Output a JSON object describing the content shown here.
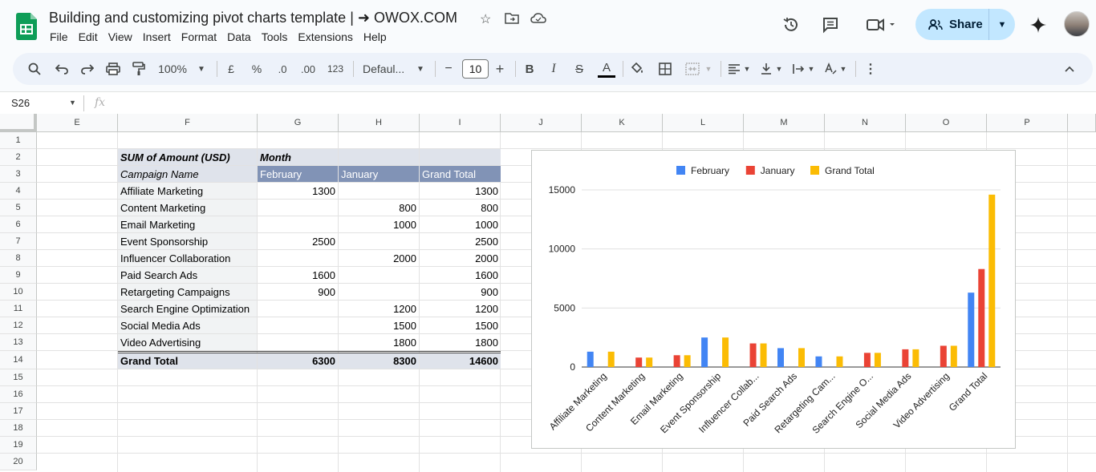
{
  "app": {
    "title": "Building and customizing pivot charts template | ➜ OWOX.COM",
    "menu": [
      "File",
      "Edit",
      "View",
      "Insert",
      "Format",
      "Data",
      "Tools",
      "Extensions",
      "Help"
    ],
    "share_label": "Share"
  },
  "toolbar": {
    "zoom": "100%",
    "currency": "£",
    "percent": "%",
    "dec_decrease": ".0",
    "dec_increase": ".00",
    "number_format": "123",
    "font": "Defaul...",
    "font_size": "10",
    "minus": "−",
    "plus": "+",
    "bold": "B",
    "italic": "I",
    "strike": "S",
    "text_color": "A"
  },
  "formula_bar": {
    "cell_ref": "S26",
    "fx": "fx"
  },
  "grid": {
    "columns": [
      "E",
      "F",
      "G",
      "H",
      "I",
      "J",
      "K",
      "L",
      "M",
      "N",
      "O",
      "P"
    ],
    "rows": [
      "1",
      "2",
      "3",
      "4",
      "5",
      "6",
      "7",
      "8",
      "9",
      "10",
      "11",
      "12",
      "13",
      "14",
      "15",
      "16",
      "17",
      "18",
      "19",
      "20"
    ]
  },
  "pivot": {
    "value_label": "SUM of Amount (USD)",
    "column_field": "Month",
    "row_field": "Campaign Name",
    "col_headers": [
      "February",
      "January",
      "Grand Total"
    ],
    "rows": [
      {
        "name": "Affiliate Marketing",
        "february": "1300",
        "january": "",
        "total": "1300"
      },
      {
        "name": "Content Marketing",
        "february": "",
        "january": "800",
        "total": "800"
      },
      {
        "name": "Email Marketing",
        "february": "",
        "january": "1000",
        "total": "1000"
      },
      {
        "name": "Event Sponsorship",
        "february": "2500",
        "january": "",
        "total": "2500"
      },
      {
        "name": "Influencer Collaboration",
        "february": "",
        "january": "2000",
        "total": "2000"
      },
      {
        "name": "Paid Search Ads",
        "february": "1600",
        "january": "",
        "total": "1600"
      },
      {
        "name": "Retargeting Campaigns",
        "february": "900",
        "january": "",
        "total": "900"
      },
      {
        "name": "Search Engine Optimization",
        "february": "",
        "january": "1200",
        "total": "1200"
      },
      {
        "name": "Social Media Ads",
        "february": "",
        "january": "1500",
        "total": "1500"
      },
      {
        "name": "Video Advertising",
        "february": "",
        "january": "1800",
        "total": "1800"
      }
    ],
    "grand_total": {
      "name": "Grand Total",
      "february": "6300",
      "january": "8300",
      "total": "14600"
    }
  },
  "chart_data": {
    "type": "bar",
    "categories": [
      "Affiliate Marketing",
      "Content Marketing",
      "Email Marketing",
      "Event Sponsorship",
      "Influencer Collab...",
      "Paid Search Ads",
      "Retargeting Cam...",
      "Search Engine O...",
      "Social Media Ads",
      "Video Advertising",
      "Grand Total"
    ],
    "series": [
      {
        "name": "February",
        "color": "#4285f4",
        "values": [
          1300,
          0,
          0,
          2500,
          0,
          1600,
          900,
          0,
          0,
          0,
          6300
        ]
      },
      {
        "name": "January",
        "color": "#ea4335",
        "values": [
          0,
          800,
          1000,
          0,
          2000,
          0,
          0,
          1200,
          1500,
          1800,
          8300
        ]
      },
      {
        "name": "Grand Total",
        "color": "#fbbc04",
        "values": [
          1300,
          800,
          1000,
          2500,
          2000,
          1600,
          900,
          1200,
          1500,
          1800,
          14600
        ]
      }
    ],
    "y_ticks": [
      "0",
      "5000",
      "10000",
      "15000"
    ],
    "ylim": [
      0,
      15000
    ],
    "legend_position": "top",
    "grid": true
  }
}
